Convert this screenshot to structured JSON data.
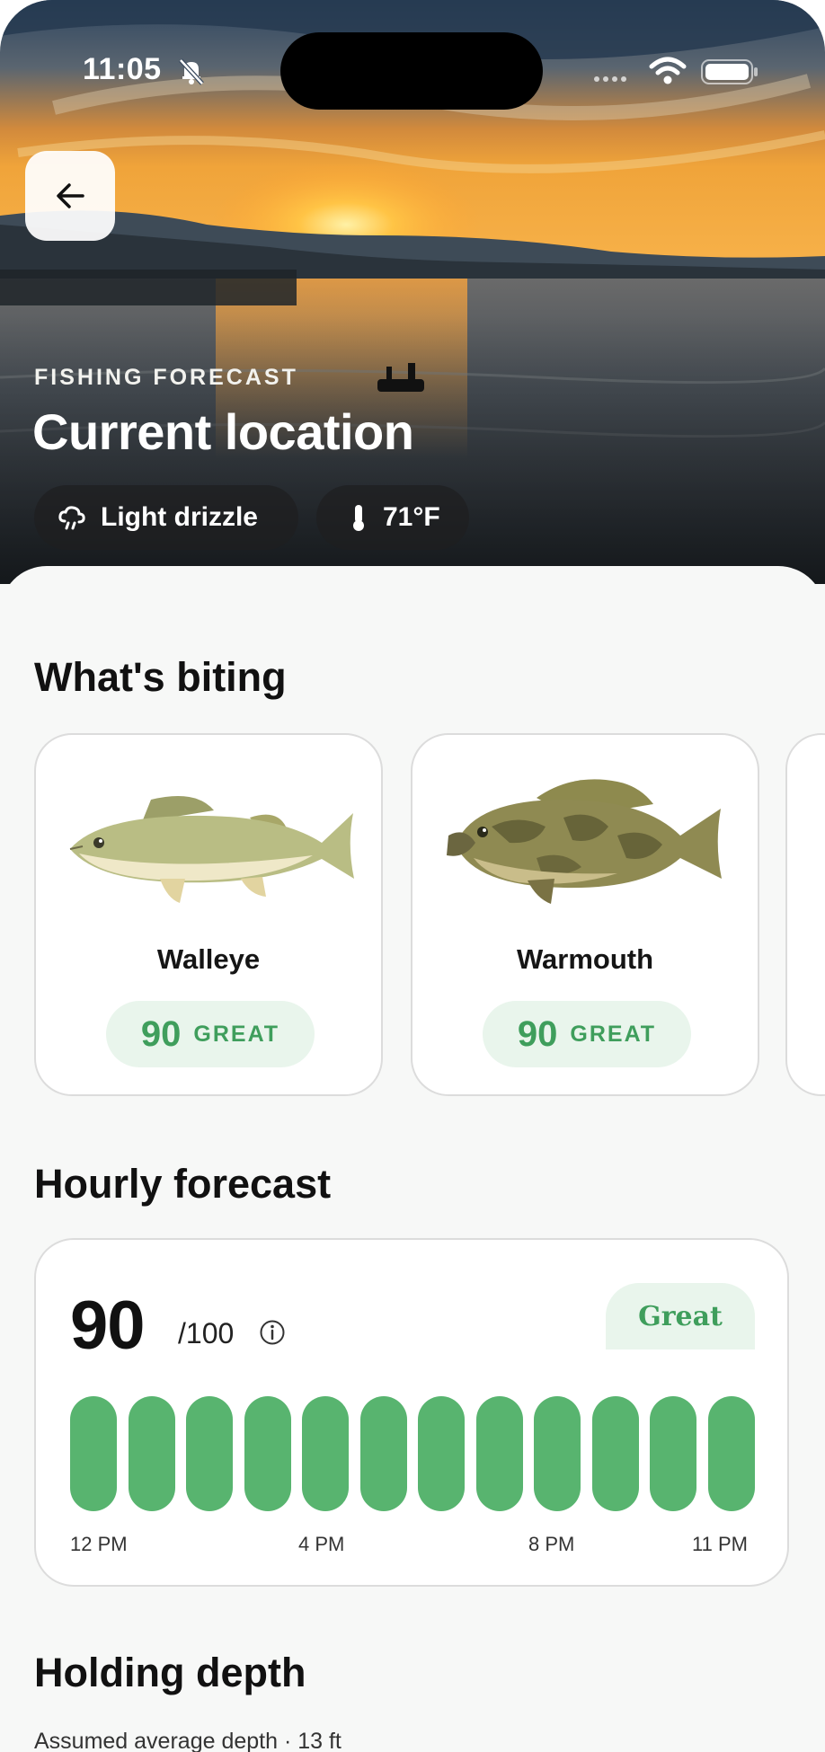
{
  "status_bar": {
    "time": "11:05"
  },
  "hero": {
    "eyebrow": "FISHING FORECAST",
    "title": "Current location",
    "weather_chip": {
      "icon": "drizzle-cloud-icon",
      "label": "Light drizzle"
    },
    "temp_chip": {
      "icon": "thermometer-icon",
      "label": "71°F"
    }
  },
  "biting": {
    "title": "What's biting",
    "cards": [
      {
        "name": "Walleye",
        "score": "90",
        "rating": "GREAT"
      },
      {
        "name": "Warmouth",
        "score": "90",
        "rating": "GREAT"
      }
    ]
  },
  "hourly": {
    "title": "Hourly forecast",
    "score": "90",
    "max": "/100",
    "rating": "Great",
    "bar_count": 12,
    "ticks": [
      "12 PM",
      "4 PM",
      "8 PM",
      "11 PM"
    ]
  },
  "depth": {
    "title": "Holding depth",
    "subtitle": "Assumed average depth · 13 ft"
  },
  "colors": {
    "accent_green": "#58b46f",
    "score_text_green": "#3f9e5c",
    "pill_bg": "#e9f5ec"
  }
}
